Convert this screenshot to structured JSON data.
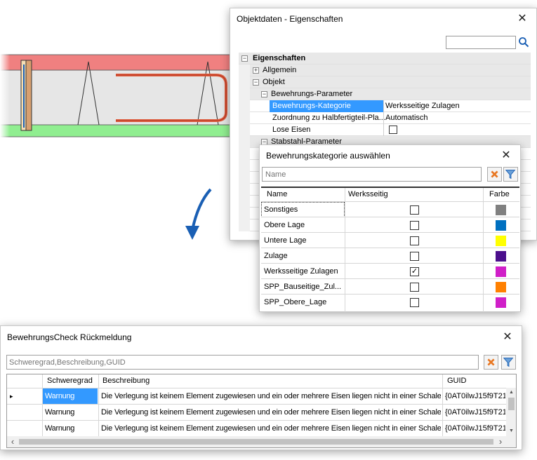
{
  "objektdaten": {
    "title": "Objektdaten - Eigenschaften",
    "close_glyph": "✕",
    "search_value": "",
    "rows": {
      "eigenschaften": "Eigenschaften",
      "allgemein": "Allgemein",
      "objekt": "Objekt",
      "bewehrungs_parameter": "Bewehrungs-Parameter",
      "bewehrungs_kategorie": {
        "label": "Bewehrungs-Kategorie",
        "value": "Werksseitige Zulagen"
      },
      "zuordnung": {
        "label": "Zuordnung zu Halbfertigteil-Pla...",
        "value": "Automatisch"
      },
      "lose_eisen": {
        "label": "Lose Eisen",
        "checked": false
      },
      "stabstahl_parameter": "Stabstahl-Parameter"
    },
    "expanders": {
      "minus": "−",
      "plus": "+"
    }
  },
  "kategorie": {
    "title": "Bewehrungskategorie auswählen",
    "close_glyph": "✕",
    "filter_placeholder": "Name",
    "columns": {
      "name": "Name",
      "werksseitig": "Werksseitig",
      "farbe": "Farbe"
    },
    "rows": [
      {
        "name": "Sonstiges",
        "werksseitig": false,
        "color": "#808080"
      },
      {
        "name": "Obere Lage",
        "werksseitig": false,
        "color": "#0070c0"
      },
      {
        "name": "Untere Lage",
        "werksseitig": false,
        "color": "#ffff00"
      },
      {
        "name": "Zulage",
        "werksseitig": false,
        "color": "#4b0f8c"
      },
      {
        "name": "Werksseitige Zulagen",
        "werksseitig": true,
        "color": "#d01fc8"
      },
      {
        "name": "SPP_Bauseitige_Zul...",
        "werksseitig": false,
        "color": "#ff8000"
      },
      {
        "name": "SPP_Obere_Lage",
        "werksseitig": false,
        "color": "#d01fc8"
      }
    ],
    "check_glyph": "✓"
  },
  "rueckmeldung": {
    "title": "BewehrungsCheck Rückmeldung",
    "close_glyph": "✕",
    "filter_placeholder": "Schweregrad,Beschreibung,GUID",
    "columns": {
      "schweregrad": "Schweregrad",
      "beschreibung": "Beschreibung",
      "guid": "GUID"
    },
    "row_marker": "▸",
    "rows": [
      {
        "schweregrad": "Warnung",
        "beschreibung": "Die Verlegung ist keinem Element zugewiesen und ein oder mehrere Eisen liegen nicht in einer Schale.",
        "guid": "{0AT0ilwJ15f9T21"
      },
      {
        "schweregrad": "Warnung",
        "beschreibung": "Die Verlegung ist keinem Element zugewiesen und ein oder mehrere Eisen liegen nicht in einer Schale.",
        "guid": "{0AT0ilwJ15f9T21"
      },
      {
        "schweregrad": "Warnung",
        "beschreibung": "Die Verlegung ist keinem Element zugewiesen und ein oder mehrere Eisen liegen nicht in einer Schale.",
        "guid": "{0AT0ilwJ15f9T21"
      }
    ],
    "scroll": {
      "up": "▲",
      "down": "▼",
      "left": "‹",
      "right": "›"
    }
  },
  "colors": {
    "selection": "#3399ff",
    "slab_top": "#f08080",
    "slab_bottom": "#90ee90",
    "rebar": "#e06040",
    "arrow": "#1a5fb4",
    "clear_x": "#e87722"
  },
  "icons": [
    "search-icon",
    "close-icon",
    "clear-filter-icon",
    "filter-icon",
    "curved-arrow-icon"
  ]
}
